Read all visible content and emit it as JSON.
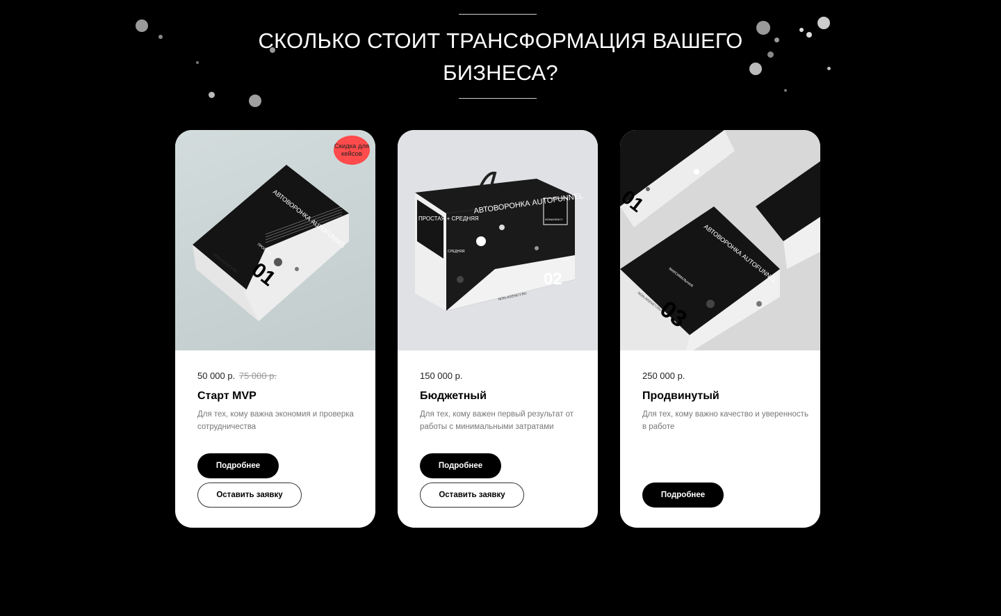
{
  "section": {
    "title_line1": "СКОЛЬКО СТОИТ ТРАНСФОРМАЦИЯ ВАШЕГО",
    "title_line2": "БИЗНЕСА?"
  },
  "colors": {
    "background": "#000000",
    "card": "#ffffff",
    "badge": "#ff4b4b",
    "button_dark": "#000000"
  },
  "plans": [
    {
      "price": "50 000 р.",
      "old_price": "75 000 р.",
      "name": "Старт MVP",
      "description": "Для тех, кому важна экономия и проверка сотрудничества",
      "badge": "Скидка для кейсов",
      "more_label": "Подробнее",
      "apply_label": "Оставить заявку",
      "image": {
        "box_title": "АВТОВОРОНКА AUTOFUNNEL",
        "box_number": "01",
        "box_level": "ПРОСТАЯ",
        "box_site": "NON-AGENCY.RU"
      }
    },
    {
      "price": "150 000 р.",
      "name": "Бюджетный",
      "description": "Для тех, кому важен первый результат от работы с минимальными затратами",
      "more_label": "Подробнее",
      "apply_label": "Оставить заявку",
      "image": {
        "box_title": "АВТОВОРОНКА AUTOFUNNEL",
        "box_number": "02",
        "box_side": "ПРОСТАЯ + СРЕДНЯЯ",
        "box_level": "СРЕДНЯЯ",
        "box_site": "NON-AGENCY.RU",
        "box_brand": "NONAGENCY"
      }
    },
    {
      "price": "250 000 р.",
      "name": "Продвинутый",
      "description": "Для тех, кому важно качество и уверенность в работе",
      "more_label": "Подробнее",
      "image": {
        "box_title": "АВТОВОРОНКА AUTOFUNNEL",
        "box_number": "03",
        "box_number_top": "01",
        "box_level": "МАКСИМАЛЬНАЯ",
        "box_site": "NON-AGENCY.RU"
      }
    }
  ]
}
